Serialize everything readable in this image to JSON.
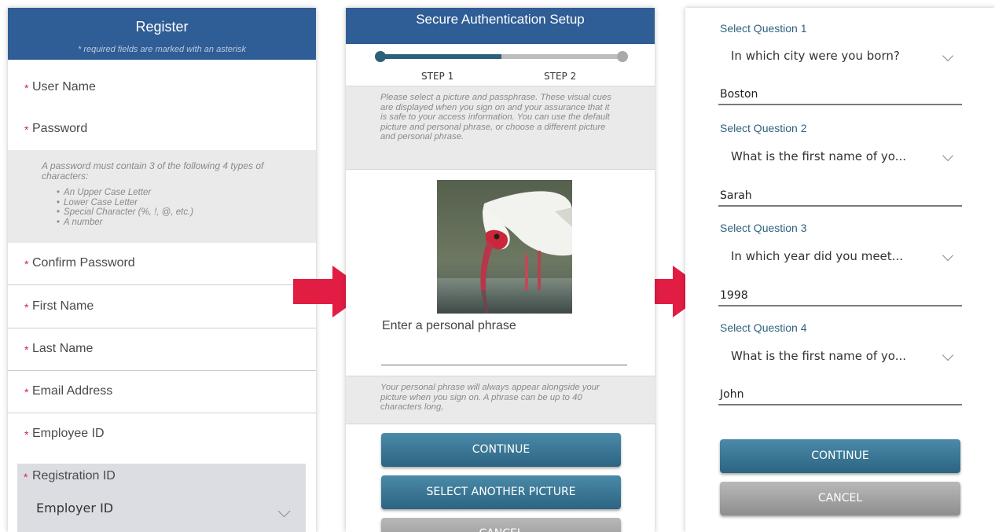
{
  "colors": {
    "header_blue": "#2f5d95",
    "required_star": "#d6263b",
    "teal_button": "#2c6482",
    "gray_button": "#8e8e8e",
    "arrow": "#e21d44",
    "question_label": "#2f6280"
  },
  "register": {
    "title": "Register",
    "note": "* required fields are marked with an asterisk",
    "required_marker": "*",
    "fields": {
      "user_name": "User Name",
      "password": "Password",
      "confirm_password": "Confirm Password",
      "first_name": "First Name",
      "last_name": "Last Name",
      "email": "Email Address",
      "employee_id": "Employee ID"
    },
    "password_rules": {
      "intro": "A password must contain 3 of the following 4 types of characters:",
      "items": [
        "An Upper Case Letter",
        "Lower Case Letter",
        "Special Character (%, !, @, etc.)",
        "A number"
      ]
    },
    "registration_id": {
      "label": "Registration ID",
      "selected": "Employer ID",
      "icon": "chevron-down-icon"
    }
  },
  "arrows": {
    "icon": "right-arrow-icon"
  },
  "auth_setup": {
    "title": "Secure Authentication Setup",
    "progress": 0.5,
    "steps": [
      "STEP 1",
      "STEP 2"
    ],
    "info": "Please select a picture and passphrase. These visual cues are displayed when you sign on and your assurance that it is safe to your access information. You can use the default picture and personal phrase, or choose a different picture and personal phrase.",
    "picture_subject": "white ibis bird",
    "phrase_label": "Enter a personal phrase",
    "phrase_value": "",
    "info2": "Your personal phrase will always appear alongside your picture when you sign on. A phrase can be up to 40 characters long,",
    "buttons": {
      "continue": "CONTINUE",
      "select_another": "SELECT ANOTHER PICTURE",
      "cancel": "CANCEL"
    }
  },
  "security_questions": {
    "questions": [
      {
        "label": "Select Question 1",
        "selected": "In which city were you born?",
        "answer": "Boston"
      },
      {
        "label": "Select Question 2",
        "selected": "What is the first name of yo...",
        "answer": "Sarah"
      },
      {
        "label": "Select Question 3",
        "selected": "In which year did you meet...",
        "answer": "1998"
      },
      {
        "label": "Select Question 4",
        "selected": "What is the first name of yo...",
        "answer": "John"
      }
    ],
    "buttons": {
      "continue": "CONTINUE",
      "cancel": "CANCEL"
    }
  }
}
